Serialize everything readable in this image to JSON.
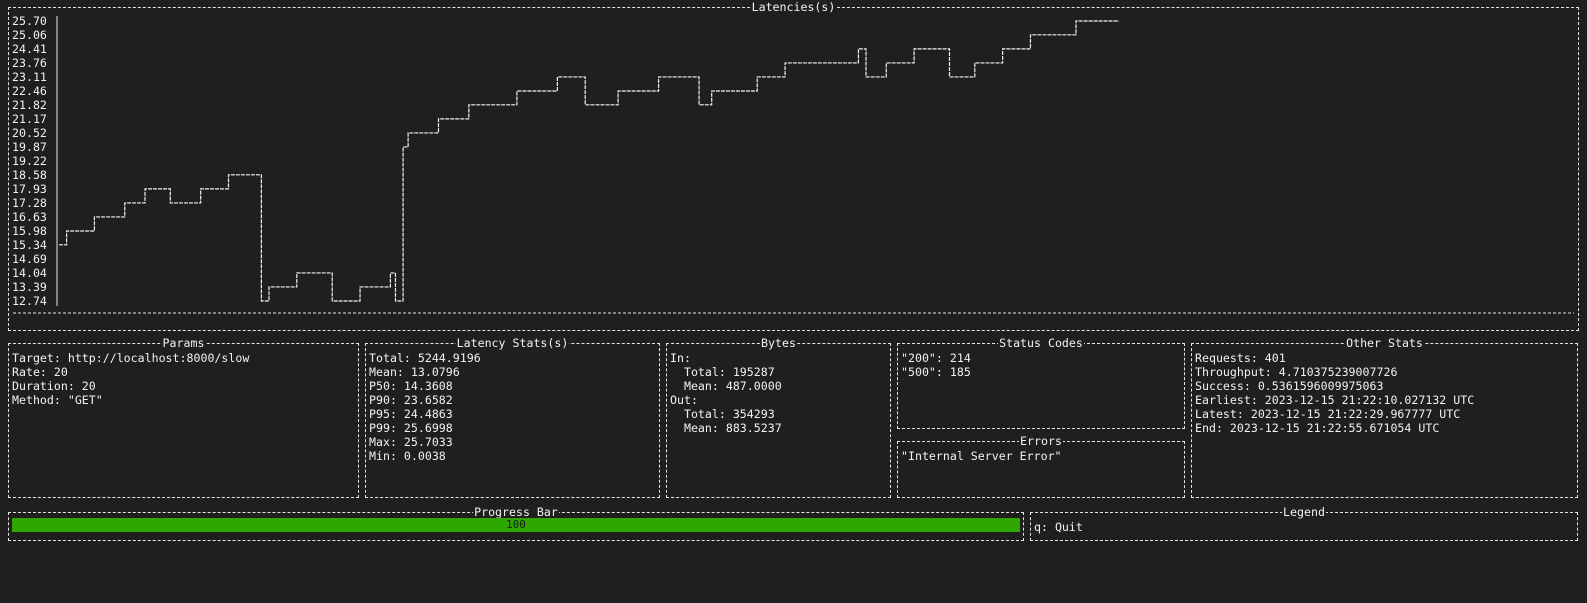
{
  "latencies": {
    "title": "Latencies(s)",
    "chart_data": {
      "type": "line",
      "title": "Latencies(s)",
      "xlabel": "",
      "ylabel": "",
      "ylim": [
        12.74,
        25.7
      ],
      "yticks": [
        "25.70",
        "25.06",
        "24.41",
        "23.76",
        "23.11",
        "22.46",
        "21.82",
        "21.17",
        "20.52",
        "19.87",
        "19.22",
        "18.58",
        "17.93",
        "17.28",
        "16.63",
        "15.98",
        "15.34",
        "14.69",
        "14.04",
        "13.39",
        "12.74"
      ],
      "series": [
        {
          "x": [
            0,
            1,
            2,
            3,
            4,
            5,
            6,
            7,
            8,
            9,
            10,
            11,
            12,
            13,
            14,
            15,
            16,
            17,
            18,
            19,
            20,
            21,
            22,
            23,
            24,
            25,
            26,
            27,
            28,
            29,
            30,
            31,
            32,
            33,
            34,
            35,
            36,
            37,
            38,
            39,
            40,
            41,
            42,
            43,
            44,
            45,
            46,
            47,
            48,
            49,
            50,
            51,
            52,
            53,
            54,
            55,
            56,
            57,
            58,
            59,
            60,
            61,
            62,
            63,
            64,
            65,
            66,
            67,
            68,
            69,
            70,
            71,
            72,
            73,
            74,
            75,
            76,
            77,
            78,
            79,
            80,
            81,
            82,
            83,
            84,
            85,
            86,
            87,
            88,
            89,
            90,
            91,
            92,
            93,
            94,
            95,
            96,
            97,
            98,
            99,
            100,
            101,
            102,
            103,
            104,
            105,
            106,
            107,
            108,
            109,
            110,
            111,
            112,
            113,
            114,
            115,
            116,
            117,
            118,
            119,
            120,
            121,
            122,
            123,
            124,
            125,
            126,
            127,
            128,
            129,
            130,
            131,
            132,
            133,
            134,
            135,
            136,
            137,
            138,
            139,
            140,
            141,
            142,
            143,
            144,
            145,
            146,
            147,
            148,
            149,
            150,
            151,
            152,
            153,
            154,
            155,
            156,
            157,
            158,
            159,
            160,
            161,
            162,
            163,
            164,
            165,
            166,
            167,
            168,
            169,
            170,
            171,
            172,
            173,
            174,
            175,
            176,
            177,
            178,
            179,
            180,
            181,
            182,
            183,
            184,
            185,
            186,
            187,
            188,
            189,
            190,
            191,
            192,
            193,
            194,
            195,
            196,
            197,
            198,
            199,
            200,
            201,
            202,
            203,
            204,
            205,
            206,
            207,
            208,
            209,
            210,
            211,
            212,
            213,
            214,
            215,
            216,
            217,
            218,
            219,
            220,
            221,
            222,
            223,
            224,
            225,
            226,
            227,
            228,
            229,
            230,
            231,
            232,
            233,
            234,
            235,
            236,
            237,
            238,
            239,
            240,
            241,
            242,
            243,
            244,
            245,
            246,
            247,
            248,
            249,
            250,
            251,
            252,
            253,
            254,
            255,
            256,
            257,
            258,
            259,
            260,
            261,
            262,
            263,
            264,
            265,
            266,
            267,
            268,
            269,
            270,
            271,
            272,
            273,
            274,
            275,
            276,
            277,
            278,
            279,
            280,
            281,
            282,
            283,
            284,
            285,
            286,
            287,
            288,
            289,
            290,
            291,
            292,
            293,
            294,
            295,
            296,
            297,
            298,
            299,
            300,
            301,
            302,
            303,
            304,
            305,
            306,
            307,
            308,
            309,
            310,
            311,
            312,
            313,
            314,
            315,
            316,
            317,
            318,
            319,
            320,
            321,
            322,
            323,
            324,
            325,
            326,
            327,
            328,
            329,
            330,
            331,
            332,
            333,
            334,
            335,
            336,
            337,
            338,
            339,
            340,
            341,
            342,
            343,
            344,
            345,
            346,
            347,
            348,
            349,
            350,
            351,
            352,
            353,
            354,
            355,
            356,
            357,
            358,
            359,
            360,
            361,
            362,
            363,
            364,
            365,
            366,
            367,
            368,
            369,
            370,
            371,
            372,
            373,
            374,
            375,
            376,
            377,
            378,
            379,
            380,
            381,
            382,
            383,
            384,
            385,
            386,
            387,
            388,
            389,
            390,
            391,
            392,
            393,
            394,
            395,
            396,
            397,
            398,
            399,
            400
          ],
          "steps": [
            [
              0,
              15.34
            ],
            [
              3,
              15.98
            ],
            [
              14,
              16.63
            ],
            [
              26,
              17.28
            ],
            [
              34,
              17.93
            ],
            [
              44,
              17.28
            ],
            [
              56,
              17.93
            ],
            [
              67,
              18.58
            ],
            [
              80,
              12.74
            ],
            [
              83,
              13.39
            ],
            [
              94,
              14.04
            ],
            [
              108,
              12.74
            ],
            [
              119,
              13.39
            ],
            [
              131,
              14.04
            ],
            [
              133,
              12.74
            ],
            [
              136,
              19.87
            ],
            [
              138,
              20.52
            ],
            [
              150,
              21.17
            ],
            [
              162,
              21.82
            ],
            [
              181,
              22.46
            ],
            [
              197,
              23.11
            ],
            [
              208,
              21.82
            ],
            [
              221,
              22.46
            ],
            [
              237,
              23.11
            ],
            [
              253,
              21.82
            ],
            [
              258,
              22.46
            ],
            [
              276,
              23.11
            ],
            [
              287,
              23.76
            ],
            [
              316,
              24.41
            ],
            [
              319,
              23.11
            ],
            [
              327,
              23.76
            ],
            [
              338,
              24.41
            ],
            [
              352,
              23.11
            ],
            [
              362,
              23.76
            ],
            [
              373,
              24.41
            ],
            [
              384,
              25.06
            ],
            [
              402,
              25.7
            ],
            [
              419,
              25.7
            ]
          ]
        }
      ]
    }
  },
  "params": {
    "title": "Params",
    "lines": [
      "Target: http://localhost:8000/slow",
      "Rate: 20",
      "Duration: 20",
      "Method: \"GET\""
    ]
  },
  "latency_stats": {
    "title": "Latency Stats(s)",
    "lines": [
      "Total: 5244.9196",
      "Mean: 13.0796",
      "P50: 14.3608",
      "P90: 23.6582",
      "P95: 24.4863",
      "P99: 25.6998",
      "Max: 25.7033",
      "Min: 0.0038"
    ]
  },
  "bytes": {
    "title": "Bytes",
    "lines": [
      "In:",
      "  Total: 195287",
      "  Mean: 487.0000",
      "Out:",
      "  Total: 354293",
      "  Mean: 883.5237"
    ]
  },
  "status_codes": {
    "title": "Status Codes",
    "lines": [
      "\"200\": 214",
      "\"500\": 185"
    ]
  },
  "errors": {
    "title": "Errors",
    "lines": [
      "\"Internal Server Error\""
    ]
  },
  "other_stats": {
    "title": "Other Stats",
    "lines": [
      "Requests: 401",
      "Throughput: 4.710375239007726",
      "Success: 0.5361596009975063",
      "Earliest: 2023-12-15 21:22:10.027132 UTC",
      "Latest: 2023-12-15 21:22:29.967777 UTC",
      "End: 2023-12-15 21:22:55.671054 UTC"
    ]
  },
  "progress": {
    "title": "Progress Bar",
    "value": 100,
    "label": "100",
    "color": "#2ea800"
  },
  "legend": {
    "title": "Legend",
    "lines": [
      "q: Quit"
    ]
  }
}
